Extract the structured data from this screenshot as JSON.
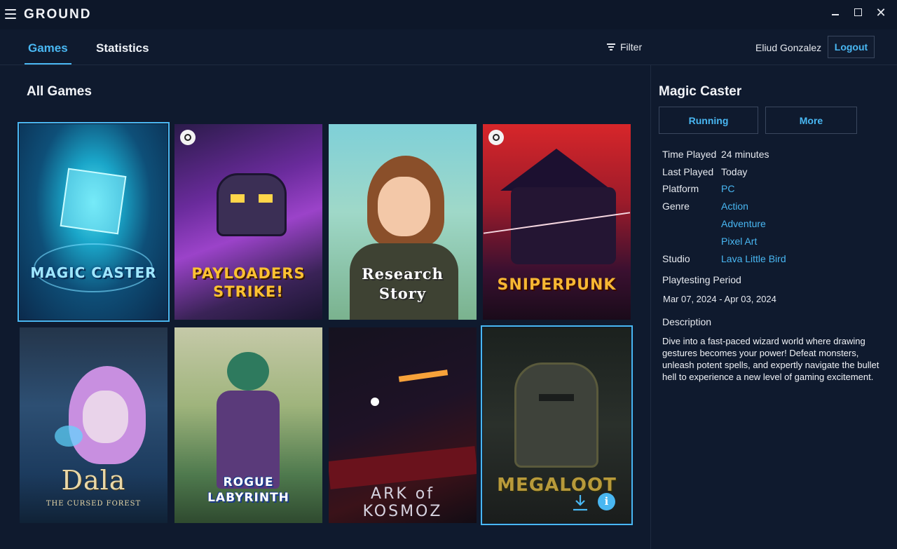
{
  "app": {
    "logo": "GROUND"
  },
  "window": {
    "close_glyph": "✕"
  },
  "nav": {
    "tabs": [
      "Games",
      "Statistics"
    ],
    "filter_label": "Filter",
    "user_name": "Eliud Gonzalez",
    "logout_label": "Logout"
  },
  "main": {
    "section_title": "All Games",
    "games": [
      {
        "title": "MAGIC CASTER",
        "steam": false,
        "selected": true
      },
      {
        "title": "PAYLOADERS STRIKE!",
        "steam": true,
        "selected": false
      },
      {
        "title": "Research Story",
        "steam": false,
        "selected": false
      },
      {
        "title": "SNIPERPUNK",
        "steam": true,
        "selected": false
      },
      {
        "title": "Dala",
        "subtitle": "THE CURSED FOREST",
        "steam": false,
        "selected": false
      },
      {
        "title": "ROGUE LABYRINTH",
        "steam": false,
        "selected": false
      },
      {
        "title": "ARK of KOSMOZ",
        "steam": false,
        "selected": false
      },
      {
        "title": "MEGALOOT",
        "steam": false,
        "selected": false,
        "hovered": true,
        "info_glyph": "i"
      }
    ]
  },
  "panel": {
    "title": "Magic Caster",
    "running_label": "Running",
    "more_label": "More",
    "labels": {
      "time_played": "Time Played",
      "last_played": "Last Played",
      "platform": "Platform",
      "genre": "Genre",
      "studio": "Studio",
      "playtesting_period": "Playtesting Period",
      "description": "Description"
    },
    "values": {
      "time_played": "24 minutes",
      "last_played": "Today",
      "platform": "PC",
      "genres": [
        "Action",
        "Adventure",
        "Pixel Art"
      ],
      "studio": "Lava Little Bird",
      "playtesting_period": "Mar 07, 2024 - Apr 03, 2024",
      "description": "Dive into a fast-paced wizard world where drawing gestures becomes your power! Defeat monsters, unleash potent spells, and expertly navigate the bullet hell to experience a new level of gaming excitement."
    }
  },
  "colors": {
    "accent": "#49b7f2",
    "background": "#0f1a2e",
    "titlebar": "#0d1729"
  }
}
